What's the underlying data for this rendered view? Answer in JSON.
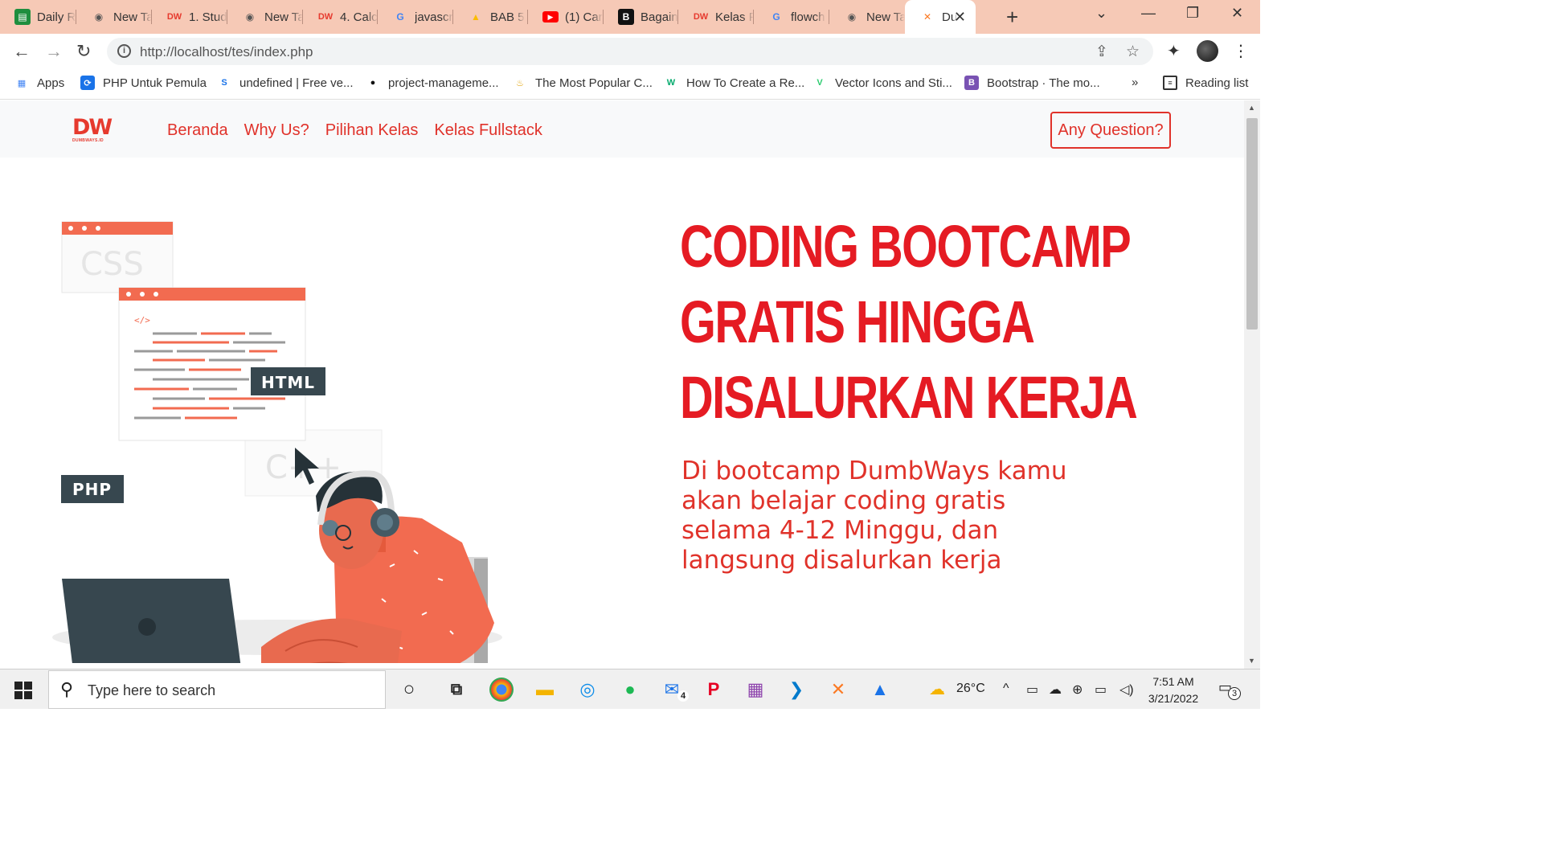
{
  "browser": {
    "tabs": [
      {
        "title": "Daily R",
        "icon": "sheets-icon",
        "color": "#1e8e3e"
      },
      {
        "title": "New Ta",
        "icon": "chrome-icon",
        "color": "#555555"
      },
      {
        "title": "1. Stud",
        "icon": "dumbways-icon",
        "color": "#e63a2e"
      },
      {
        "title": "New Ta",
        "icon": "chrome-icon",
        "color": "#555555"
      },
      {
        "title": "4. Calc",
        "icon": "dumbways-icon",
        "color": "#e63a2e"
      },
      {
        "title": "javascr",
        "icon": "google-icon",
        "color": "#4285f4"
      },
      {
        "title": "BAB 5",
        "icon": "drive-icon",
        "color": "#fbbc04"
      },
      {
        "title": "(1) Car",
        "icon": "youtube-icon",
        "color": "#ff0000"
      },
      {
        "title": "Bagain",
        "icon": "bold-b-icon",
        "color": "#111111"
      },
      {
        "title": "Kelas F",
        "icon": "dumbways-icon",
        "color": "#e63a2e"
      },
      {
        "title": "flowch",
        "icon": "google-icon",
        "color": "#4285f4"
      },
      {
        "title": "New Ta",
        "icon": "chrome-icon",
        "color": "#555555"
      },
      {
        "title": "Du",
        "icon": "xampp-icon",
        "color": "#fb7a24",
        "active": true
      }
    ],
    "url": "http://localhost/tes/index.php",
    "bookmarks": [
      {
        "label": "Apps",
        "icon": "apps-grid-icon"
      },
      {
        "label": "PHP Untuk Pemula",
        "icon": "php-icon"
      },
      {
        "label": "undefined | Free ve...",
        "icon": "s-logo-icon"
      },
      {
        "label": "project-manageme...",
        "icon": "github-icon"
      },
      {
        "label": "The Most Popular C...",
        "icon": "cup-icon"
      },
      {
        "label": "How To Create a Re...",
        "icon": "w3-icon"
      },
      {
        "label": "Vector Icons and Sti...",
        "icon": "vector-icon"
      },
      {
        "label": "Bootstrap · The mo...",
        "icon": "bootstrap-icon"
      }
    ],
    "bookmarks_overflow": "»",
    "reading_list": "Reading list"
  },
  "site": {
    "logo_mark": "DW",
    "logo_sub": "DUMBWAYS.ID",
    "nav": [
      "Beranda",
      "Why Us?",
      "Pilihan Kelas",
      "Kelas Fullstack"
    ],
    "cta": "Any Question?",
    "headline": [
      "CODING BOOTCAMP",
      "GRATIS HINGGA",
      "DISALURKAN KERJA"
    ],
    "subtext": "Di bootcamp DumbWays kamu akan belajar coding gratis selama 4-12 Minggu, dan langsung disalurkan kerja",
    "illustration_labels": {
      "css": "CSS",
      "html": "HTML",
      "php": "PHP",
      "cpp": "C++",
      "code_tag": "</>"
    },
    "brand_color": "#e51b23"
  },
  "taskbar": {
    "search_placeholder": "Type here to search",
    "weather": "26°C",
    "time": "7:51 AM",
    "date": "3/21/2022",
    "mail_badge": "4",
    "notification_count": "3"
  }
}
